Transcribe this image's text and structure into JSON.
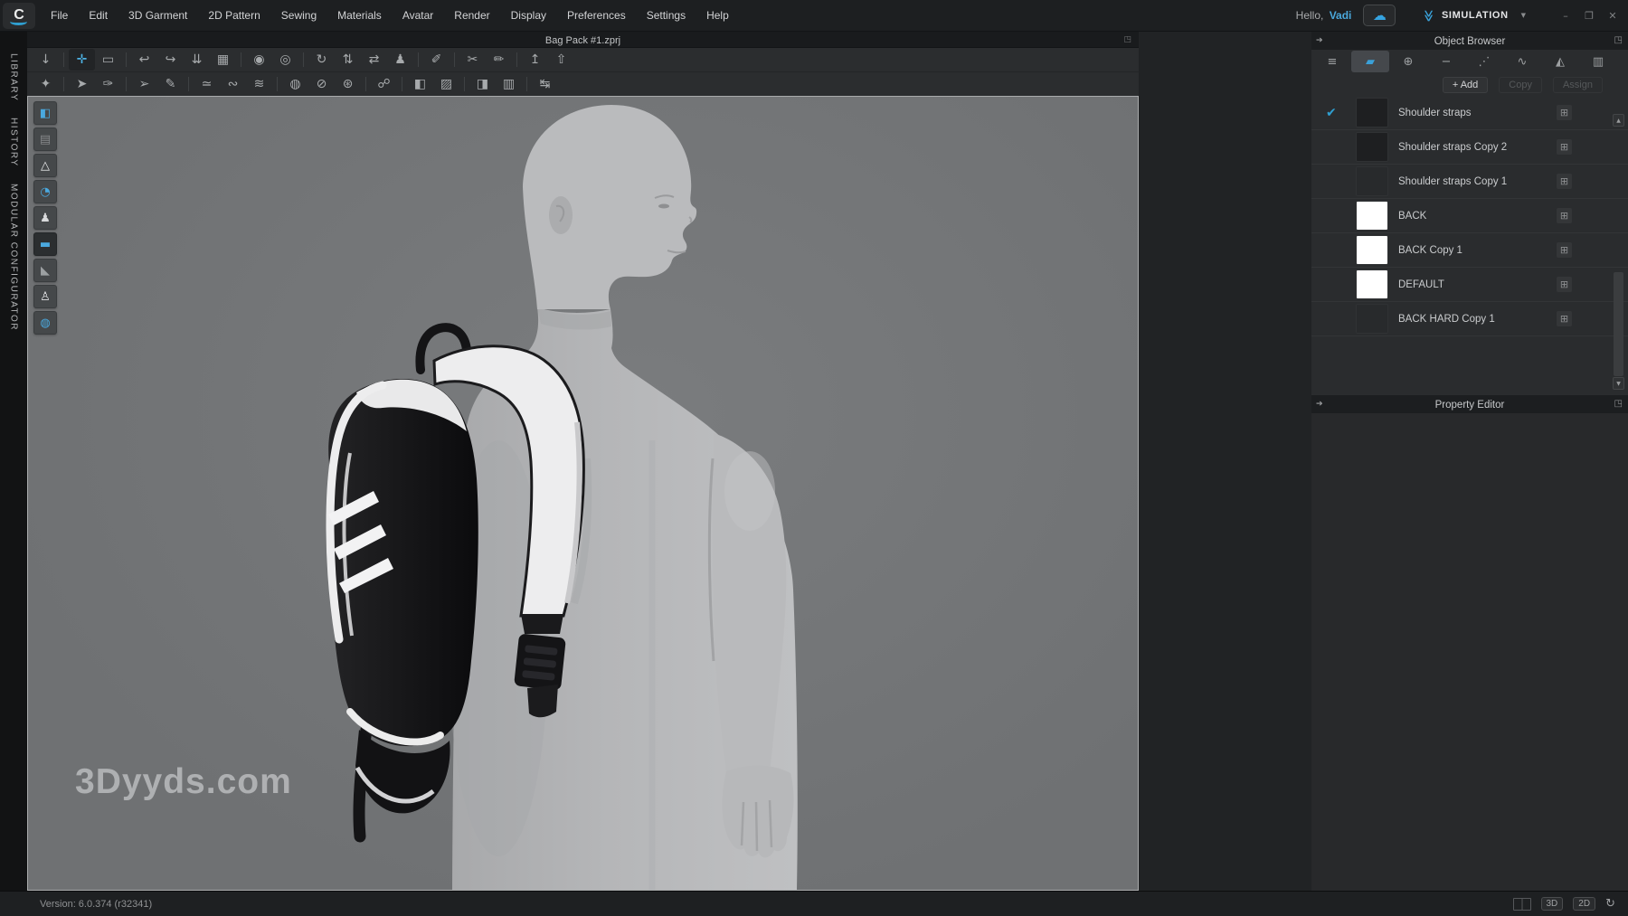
{
  "titlebar": {
    "logo_letter": "C",
    "menu": [
      "File",
      "Edit",
      "3D Garment",
      "2D Pattern",
      "Sewing",
      "Materials",
      "Avatar",
      "Render",
      "Display",
      "Preferences",
      "Settings",
      "Help"
    ],
    "greeting": "Hello,",
    "username": "Vadi",
    "mode_label": "SIMULATION",
    "window_controls": [
      {
        "name": "minimize-button",
        "glyph": "–"
      },
      {
        "name": "restore-button",
        "glyph": "❐"
      },
      {
        "name": "close-button",
        "glyph": "✕"
      }
    ]
  },
  "tabbar": {
    "active_tab": "Bag Pack #1.zprj"
  },
  "side_tabs": [
    "LIBRARY",
    "HISTORY",
    "MODULAR CONFIGURATOR"
  ],
  "toolbar": {
    "row1": [
      {
        "name": "reset-2d-arrangement-icon",
        "glyph": "↓"
      },
      {
        "sep": true
      },
      {
        "name": "select-move-icon",
        "glyph": "✛",
        "active": true
      },
      {
        "name": "select-rectangle-icon",
        "glyph": "▭"
      },
      {
        "sep": true
      },
      {
        "name": "fold-arrangement-icon",
        "glyph": "↩"
      },
      {
        "name": "unfold-arrangement-icon",
        "glyph": "↪"
      },
      {
        "name": "reset-fold-icon",
        "glyph": "⇊"
      },
      {
        "name": "sewing-machine-icon",
        "glyph": "▦"
      },
      {
        "sep": true
      },
      {
        "name": "pin-icon",
        "glyph": "◉"
      },
      {
        "name": "remove-pin-icon",
        "glyph": "◎"
      },
      {
        "sep": true
      },
      {
        "name": "rotate-garment-icon",
        "glyph": "↻"
      },
      {
        "name": "move-arrangement-icon",
        "glyph": "⇅"
      },
      {
        "name": "flip-garment-icon",
        "glyph": "⇄"
      },
      {
        "name": "fit-to-avatar-icon",
        "glyph": "♟"
      },
      {
        "sep": true
      },
      {
        "name": "measure-icon",
        "glyph": "✐"
      },
      {
        "sep": true
      },
      {
        "name": "cut-sew-icon",
        "glyph": "✂"
      },
      {
        "name": "edit-sewing-icon",
        "glyph": "✏"
      },
      {
        "sep": true
      },
      {
        "name": "flip-up-left-icon",
        "glyph": "↥"
      },
      {
        "name": "flip-up-right-icon",
        "glyph": "⇧"
      }
    ],
    "row2": [
      {
        "name": "avatar-pose-icon",
        "glyph": "✦"
      },
      {
        "sep": true
      },
      {
        "name": "select-garment-icon",
        "glyph": "➤"
      },
      {
        "name": "style-line-icon",
        "glyph": "✑"
      },
      {
        "sep": true
      },
      {
        "name": "select-pattern-icon",
        "glyph": "➢"
      },
      {
        "name": "edit-pattern-icon",
        "glyph": "✎"
      },
      {
        "sep": true
      },
      {
        "name": "segment-sewing-icon",
        "glyph": "≃"
      },
      {
        "name": "free-sewing-icon",
        "glyph": "∾"
      },
      {
        "name": "mn-sewing-icon",
        "glyph": "≋"
      },
      {
        "sep": true
      },
      {
        "name": "button-icon",
        "glyph": "◍"
      },
      {
        "name": "buttonhole-icon",
        "glyph": "⊘"
      },
      {
        "name": "attach-button-icon",
        "glyph": "⊛"
      },
      {
        "sep": true
      },
      {
        "name": "zipper-icon",
        "glyph": "☍"
      },
      {
        "sep": true
      },
      {
        "name": "select-gradient-icon",
        "glyph": "◧"
      },
      {
        "name": "gradient-tool-icon",
        "glyph": "▨"
      },
      {
        "sep": true
      },
      {
        "name": "select-texture-icon",
        "glyph": "◨"
      },
      {
        "name": "edit-texture-icon",
        "glyph": "▥"
      },
      {
        "sep": true
      },
      {
        "name": "symmetry-align-icon",
        "glyph": "↹"
      }
    ]
  },
  "viewport": {
    "watermark": "3Dyyds.com",
    "display_toggles": [
      {
        "name": "toggle-show-garment",
        "glyph": "◧",
        "color": "#4aa8de"
      },
      {
        "name": "toggle-garment-mesh",
        "glyph": "▤",
        "color": "#85888a",
        "gap_after": true
      },
      {
        "name": "toggle-show-fit",
        "glyph": "△",
        "color": "#e6e7e8"
      },
      {
        "name": "toggle-strain-map",
        "glyph": "◔",
        "color": "#4aa8de"
      },
      {
        "name": "toggle-show-avatar",
        "glyph": "♟",
        "color": "#d9dadc"
      },
      {
        "name": "toggle-fabric-view",
        "glyph": "▬",
        "color": "#4aa8de",
        "active": true
      },
      {
        "name": "toggle-pattern-view",
        "glyph": "◣",
        "color": "#9ca0a2"
      },
      {
        "name": "toggle-avatar-mesh",
        "glyph": "♙",
        "color": "#e2e3e5"
      },
      {
        "name": "toggle-environment",
        "glyph": "◍",
        "color": "#4aa8de"
      }
    ]
  },
  "object_browser": {
    "title": "Object Browser",
    "tabs": [
      {
        "name": "tab-scene-list",
        "glyph": "≡",
        "color": "#9da0a2"
      },
      {
        "name": "tab-fabric",
        "glyph": "▰",
        "color": "#3aa0d8",
        "active": true
      },
      {
        "name": "tab-button",
        "glyph": "⊕",
        "color": "#9da0a2"
      },
      {
        "name": "tab-buttonhole",
        "glyph": "−",
        "color": "#9da0a2"
      },
      {
        "name": "tab-topstitch",
        "glyph": "⋰",
        "color": "#9da0a2"
      },
      {
        "name": "tab-stitch",
        "glyph": "∿",
        "color": "#9da0a2"
      },
      {
        "name": "tab-puckering",
        "glyph": "◭",
        "color": "#9da0a2"
      },
      {
        "name": "tab-zipper",
        "glyph": "▥",
        "color": "#9da0a2"
      }
    ],
    "buttons": {
      "add": "+ Add",
      "copy": "Copy",
      "assign": "Assign"
    },
    "items": [
      {
        "label": "Shoulder straps",
        "checked": true,
        "swatch": "#1e1f21"
      },
      {
        "label": "Shoulder straps Copy 2",
        "checked": false,
        "swatch": "#1e1f21"
      },
      {
        "label": "Shoulder straps Copy 1",
        "checked": false,
        "swatch": "#282a2c"
      },
      {
        "label": "BACK",
        "checked": false,
        "swatch": "#ffffff"
      },
      {
        "label": "BACK Copy 1",
        "checked": false,
        "swatch": "#ffffff"
      },
      {
        "label": "DEFAULT",
        "checked": false,
        "swatch": "#ffffff"
      },
      {
        "label": "BACK HARD Copy 1",
        "checked": false,
        "swatch": "#282a2c"
      }
    ]
  },
  "property_editor": {
    "title": "Property Editor"
  },
  "statusbar": {
    "version": "Version: 6.0.374 (r32341)",
    "btn_3d": "3D",
    "btn_2d": "2D"
  },
  "icons": {
    "cloud": "☁",
    "sim_chevron": "≫",
    "caret": "▼",
    "popup": "◳",
    "collapse_arrow": "➔",
    "check": "✔",
    "add_colorway": "⊞",
    "scroll_up": "▲",
    "scroll_down": "▼",
    "refresh": "↻"
  },
  "colors": {
    "accent": "#3aa0d8",
    "viewport_bg": "#727476",
    "panel_bg": "#2a2c2e"
  }
}
